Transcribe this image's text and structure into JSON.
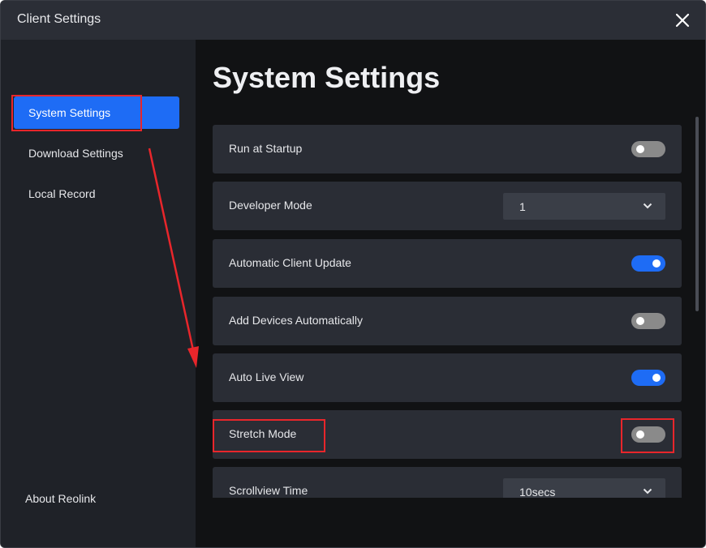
{
  "window": {
    "title": "Client Settings"
  },
  "sidebar": {
    "items": [
      {
        "label": "System Settings",
        "active": true
      },
      {
        "label": "Download Settings",
        "active": false
      },
      {
        "label": "Local Record",
        "active": false
      }
    ],
    "about_label": "About Reolink"
  },
  "main": {
    "title": "System Settings",
    "settings": [
      {
        "label": "Run at Startup",
        "control": "toggle",
        "on": false
      },
      {
        "label": "Developer Mode",
        "control": "select",
        "value": "1"
      },
      {
        "label": "Automatic Client Update",
        "control": "toggle",
        "on": true
      },
      {
        "label": "Add Devices Automatically",
        "control": "toggle",
        "on": false
      },
      {
        "label": "Auto Live View",
        "control": "toggle",
        "on": true
      },
      {
        "label": "Stretch Mode",
        "control": "toggle",
        "on": false
      },
      {
        "label": "Scrollview Time",
        "control": "select",
        "value": "10secs"
      }
    ]
  },
  "colors": {
    "accent": "#1e6cf5",
    "annotation": "#e8262b",
    "toggle_off": "#8a8a8a",
    "row_background": "#2a2d35",
    "sidebar_background": "#1f2228"
  },
  "icons": {
    "close": "close-icon",
    "dropdown": "chevron-down-icon"
  }
}
